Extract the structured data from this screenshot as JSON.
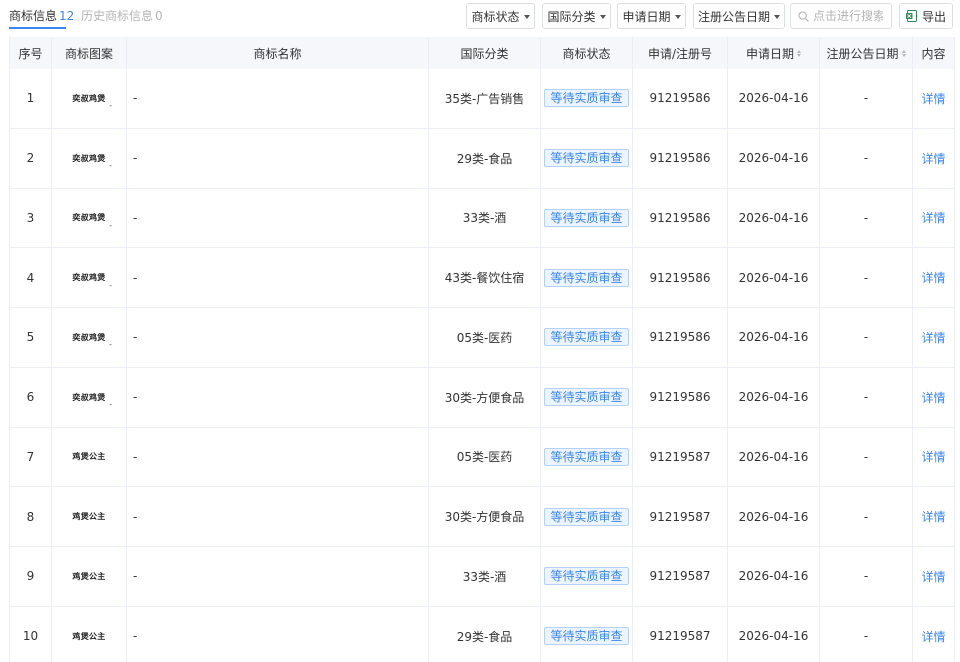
{
  "tabs": {
    "active_label": "商标信息",
    "active_count": "12",
    "inactive_label": "历史商标信息",
    "inactive_count": "0"
  },
  "filters": {
    "status_label": "商标状态",
    "class_label": "国际分类",
    "apply_date_label": "申请日期",
    "pub_date_label": "注册公告日期"
  },
  "search": {
    "placeholder": "点击进行搜索"
  },
  "export": {
    "label": "导出"
  },
  "accent_color": "#3a86f0",
  "columns": {
    "no": "序号",
    "image": "商标图案",
    "name": "商标名称",
    "class": "国际分类",
    "status": "商标状态",
    "reg": "申请/注册号",
    "apply_date": "申请日期",
    "pub_date": "注册公告日期",
    "action": "内容"
  },
  "rows": [
    {
      "no": "1",
      "image_text": "奕叔鸡煲",
      "image_dash": "-",
      "name": "-",
      "class": "35类-广告销售",
      "status": "等待实质审查",
      "reg": "91219586",
      "apply_date": "2026-04-16",
      "pub_date": "-",
      "action": "详情"
    },
    {
      "no": "2",
      "image_text": "奕叔鸡煲",
      "image_dash": "-",
      "name": "-",
      "class": "29类-食品",
      "status": "等待实质审查",
      "reg": "91219586",
      "apply_date": "2026-04-16",
      "pub_date": "-",
      "action": "详情"
    },
    {
      "no": "3",
      "image_text": "奕叔鸡煲",
      "image_dash": "-",
      "name": "-",
      "class": "33类-酒",
      "status": "等待实质审查",
      "reg": "91219586",
      "apply_date": "2026-04-16",
      "pub_date": "-",
      "action": "详情"
    },
    {
      "no": "4",
      "image_text": "奕叔鸡煲",
      "image_dash": "-",
      "name": "-",
      "class": "43类-餐饮住宿",
      "status": "等待实质审查",
      "reg": "91219586",
      "apply_date": "2026-04-16",
      "pub_date": "-",
      "action": "详情"
    },
    {
      "no": "5",
      "image_text": "奕叔鸡煲",
      "image_dash": "-",
      "name": "-",
      "class": "05类-医药",
      "status": "等待实质审查",
      "reg": "91219586",
      "apply_date": "2026-04-16",
      "pub_date": "-",
      "action": "详情"
    },
    {
      "no": "6",
      "image_text": "奕叔鸡煲",
      "image_dash": "-",
      "name": "-",
      "class": "30类-方便食品",
      "status": "等待实质审查",
      "reg": "91219586",
      "apply_date": "2026-04-16",
      "pub_date": "-",
      "action": "详情"
    },
    {
      "no": "7",
      "image_text": "鸡煲公主",
      "image_dash": "",
      "name": "-",
      "class": "05类-医药",
      "status": "等待实质审查",
      "reg": "91219587",
      "apply_date": "2026-04-16",
      "pub_date": "-",
      "action": "详情"
    },
    {
      "no": "8",
      "image_text": "鸡煲公主",
      "image_dash": "",
      "name": "-",
      "class": "30类-方便食品",
      "status": "等待实质审查",
      "reg": "91219587",
      "apply_date": "2026-04-16",
      "pub_date": "-",
      "action": "详情"
    },
    {
      "no": "9",
      "image_text": "鸡煲公主",
      "image_dash": "",
      "name": "-",
      "class": "33类-酒",
      "status": "等待实质审查",
      "reg": "91219587",
      "apply_date": "2026-04-16",
      "pub_date": "-",
      "action": "详情"
    },
    {
      "no": "10",
      "image_text": "鸡煲公主",
      "image_dash": "",
      "name": "-",
      "class": "29类-食品",
      "status": "等待实质审查",
      "reg": "91219587",
      "apply_date": "2026-04-16",
      "pub_date": "-",
      "action": "详情"
    }
  ]
}
